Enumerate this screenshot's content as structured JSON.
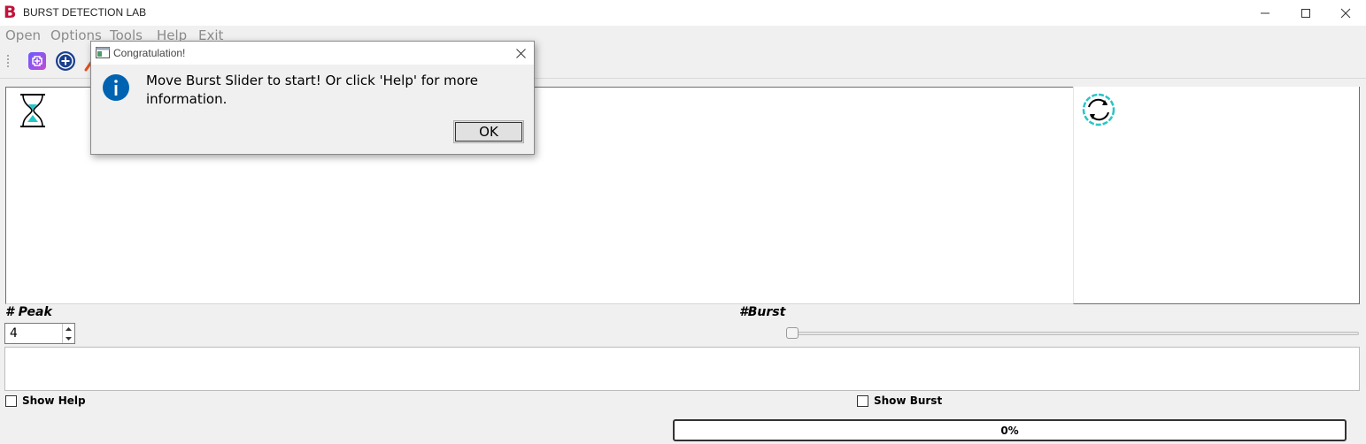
{
  "window": {
    "title": "BURST DETECTION LAB",
    "logo_letter": "B",
    "logo_color": "#c0143c",
    "controls": [
      "minimize-icon",
      "maximize-icon",
      "close-icon"
    ]
  },
  "menu": {
    "items": [
      {
        "label": "Open"
      },
      {
        "label": "Options"
      },
      {
        "label": "Tools"
      },
      {
        "label": "Help"
      },
      {
        "label": "Exit"
      }
    ]
  },
  "toolbar": {
    "buttons": [
      "add-plugin-icon",
      "add-circle-icon",
      "tool-icon"
    ]
  },
  "panels": {
    "main_icon": "hourglass-icon",
    "side_icon": "refresh-icon"
  },
  "controls": {
    "peak_label": "# Peak",
    "peak_value": "4",
    "burst_label": "#Burst",
    "burst_slider_value": 0,
    "show_help_label": "Show Help",
    "show_help_checked": false,
    "show_burst_label": "Show Burst",
    "show_burst_checked": false,
    "progress_text": "0%",
    "progress_value": 0
  },
  "dialog": {
    "title": "Congratulation!",
    "message": "Move Burst Slider to start! Or click 'Help' for more information.",
    "ok_label": "OK",
    "icon": "info-icon",
    "accent": "#0063b1"
  }
}
